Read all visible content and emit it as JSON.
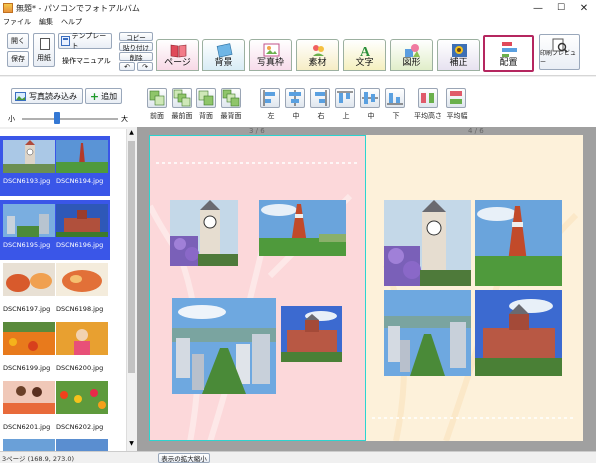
{
  "window": {
    "title": "無題* - パソコンでフォトアルバム",
    "minimize": "—",
    "maximize": "☐",
    "close": "✕"
  },
  "menu": [
    "ファイル",
    "編集",
    "ヘルプ"
  ],
  "toolbar": {
    "open": "開く",
    "save": "保存",
    "paper": "用紙",
    "template": "テンプレート",
    "manual": "操作マニュアル",
    "copy": "コピー",
    "paste": "貼り付け",
    "delete": "削除",
    "undo": "↶",
    "redo": "↷"
  },
  "tabs": [
    "ページ",
    "背景",
    "写真枠",
    "素材",
    "文字",
    "図形",
    "補正",
    "配置"
  ],
  "print_preview": "印刷プレビュー",
  "left": {
    "import": "写真読み込み",
    "add": "追加",
    "small": "小",
    "large": "大"
  },
  "arrange": {
    "order": [
      "前面",
      "最前面",
      "背面",
      "最背面"
    ],
    "align": [
      "左",
      "中",
      "右",
      "上",
      "中",
      "下"
    ],
    "even": [
      "平均高さ",
      "平均幅"
    ]
  },
  "photos": [
    {
      "name": "DSCN6193.jpg",
      "selected": true
    },
    {
      "name": "DSCN6194.jpg",
      "selected": true
    },
    {
      "name": "DSCN6195.jpg",
      "selected": true
    },
    {
      "name": "DSCN6196.jpg",
      "selected": true
    },
    {
      "name": "DSCN6197.jpg",
      "selected": false
    },
    {
      "name": "DSCN6198.jpg",
      "selected": false
    },
    {
      "name": "DSCN6199.jpg",
      "selected": false
    },
    {
      "name": "DSCN6200.jpg",
      "selected": false
    },
    {
      "name": "DSCN6201.jpg",
      "selected": false
    },
    {
      "name": "DSCN6202.jpg",
      "selected": false
    }
  ],
  "pages": {
    "left_label": "3 / 6",
    "right_label": "4 / 6"
  },
  "status": {
    "page_info": "3ページ (168.9, 273.0)",
    "zoom_button": "表示の拡大縮小"
  },
  "colors": {
    "selected": "#3a56e8",
    "page_left": "#fcd8da",
    "page_right": "#fdf1da",
    "active_tab_border": "#b5265f"
  }
}
